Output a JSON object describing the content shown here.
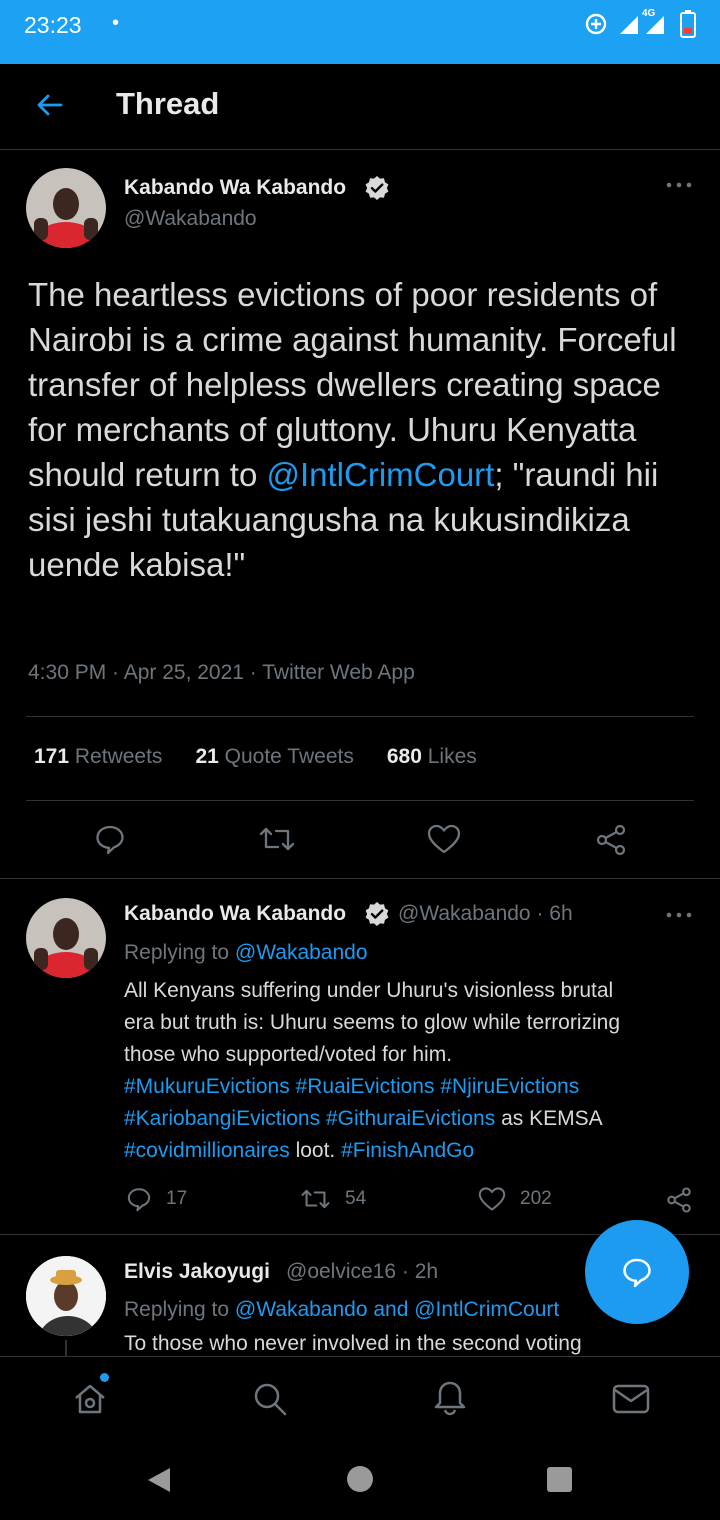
{
  "status_bar": {
    "time": "23:23",
    "dot": "•",
    "network": "4G",
    "icons": [
      "data-saver-icon",
      "signal-icon",
      "signal-4g-icon",
      "battery-low-icon"
    ]
  },
  "header": {
    "back_icon": "arrow-left-icon",
    "title": "Thread"
  },
  "main_tweet": {
    "author_name": "Kabando Wa Kabando",
    "handle": "@Wakabando",
    "verified": true,
    "text_before_mention": "The heartless evictions of poor residents of Nairobi is a crime against humanity. Forceful transfer of helpless dwellers creating space for merchants of gluttony. Uhuru Kenyatta should return to ",
    "mention": "@IntlCrimCourt",
    "text_after_mention": "; \"raundi hii sisi jeshi tutakuangusha na kukusindikiza uende kabisa!\"",
    "meta": "4:30 PM · Apr 25, 2021 · Twitter Web App",
    "stats": {
      "retweets_count": "171",
      "retweets_label": "Retweets",
      "quotes_count": "21",
      "quotes_label": "Quote Tweets",
      "likes_count": "680",
      "likes_label": "Likes"
    }
  },
  "reply1": {
    "author_name": "Kabando Wa Kabando",
    "handle_time": "@Wakabando · 6h",
    "replying_prefix": "Replying to",
    "replying_to": "@Wakabando",
    "line1": "All Kenyans suffering under Uhuru's visionless brutal",
    "line2": "era but truth is: Uhuru seems to glow while terrorizing",
    "line3": "those who supported/voted for him.",
    "tag1": "#MukuruEvictions",
    "tag2": "#RuaiEvictions",
    "tag3": "#NjiruEvictions",
    "tag4": "#KariobangiEvictions",
    "tag5": "#GithuraiEvictions",
    "text_as": "as KEMSA",
    "tag6": "#covidmillionaires",
    "text_loot": "loot.",
    "tag7": "#FinishAndGo",
    "replies": "17",
    "retweets": "54",
    "likes": "202"
  },
  "reply2": {
    "author_name": "Elvis Jakoyugi",
    "handle_time": "@oelvice16 · 2h",
    "replying_prefix": "Replying to",
    "replying_to": "@Wakabando and @IntlCrimCourt",
    "text_partial": "To those who never involved in the second voting"
  },
  "bottom_nav": [
    "home-icon",
    "search-icon",
    "notifications-icon",
    "messages-icon"
  ],
  "colors": {
    "accent": "#1d9bf0",
    "status_bar": "#1da1f2",
    "background": "#000000",
    "muted": "#6e767d"
  }
}
